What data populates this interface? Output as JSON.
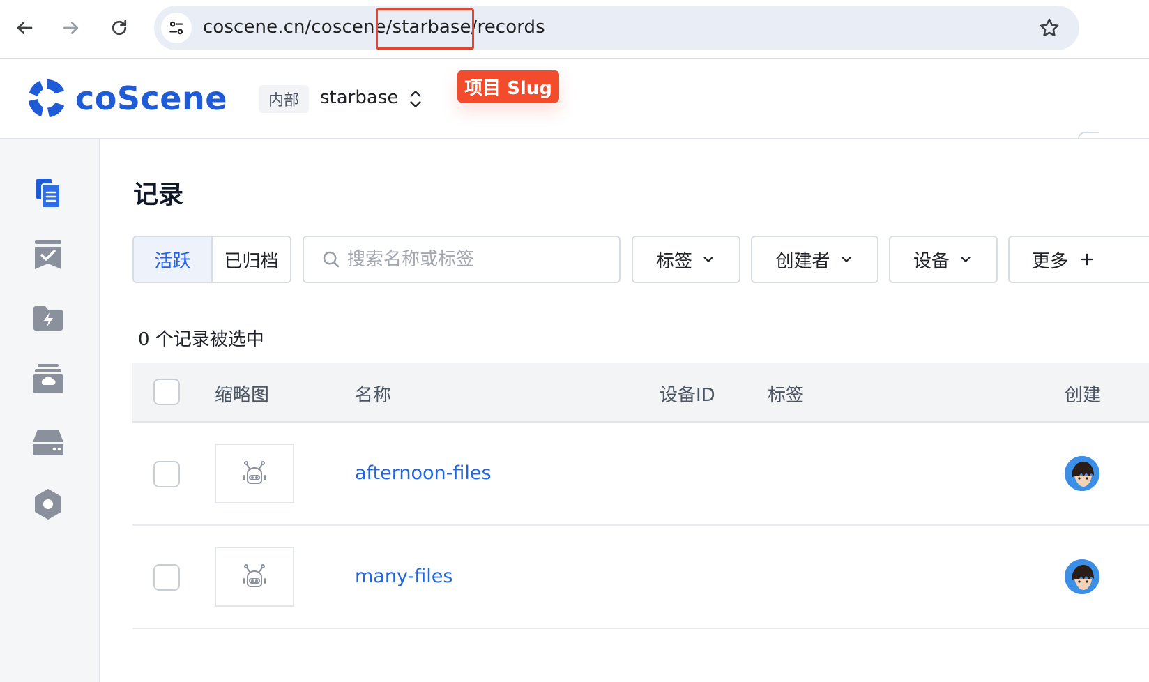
{
  "browser": {
    "url": "coscene.cn/coscene/starbase/records"
  },
  "callout": {
    "label": "项目 Slug"
  },
  "header": {
    "logo_text": "coScene",
    "org_badge": "内部",
    "project_name": "starbase"
  },
  "sidebar": {
    "items": [
      {
        "icon": "records-icon"
      },
      {
        "icon": "tasks-icon"
      },
      {
        "icon": "actions-icon"
      },
      {
        "icon": "data-archive-icon"
      },
      {
        "icon": "devices-icon"
      },
      {
        "icon": "settings-icon"
      }
    ]
  },
  "main": {
    "title": "记录",
    "tabs": [
      {
        "label": "活跃",
        "active": true
      },
      {
        "label": "已归档",
        "active": false
      }
    ],
    "search_placeholder": "搜索名称或标签",
    "filters": {
      "tags": "标签",
      "creator": "创建者",
      "device": "设备",
      "more": "更多"
    },
    "selected_count": "0 个记录被选中",
    "columns": {
      "thumbnail": "缩略图",
      "name": "名称",
      "device_id": "设备ID",
      "tags": "标签",
      "creator": "创建"
    },
    "rows": [
      {
        "name": "afternoon-files"
      },
      {
        "name": "many-files"
      }
    ]
  },
  "colors": {
    "brand": "#1f5bd6",
    "link": "#2166e0",
    "callout": "#f24c2c",
    "highlight_border": "#e8432d"
  }
}
